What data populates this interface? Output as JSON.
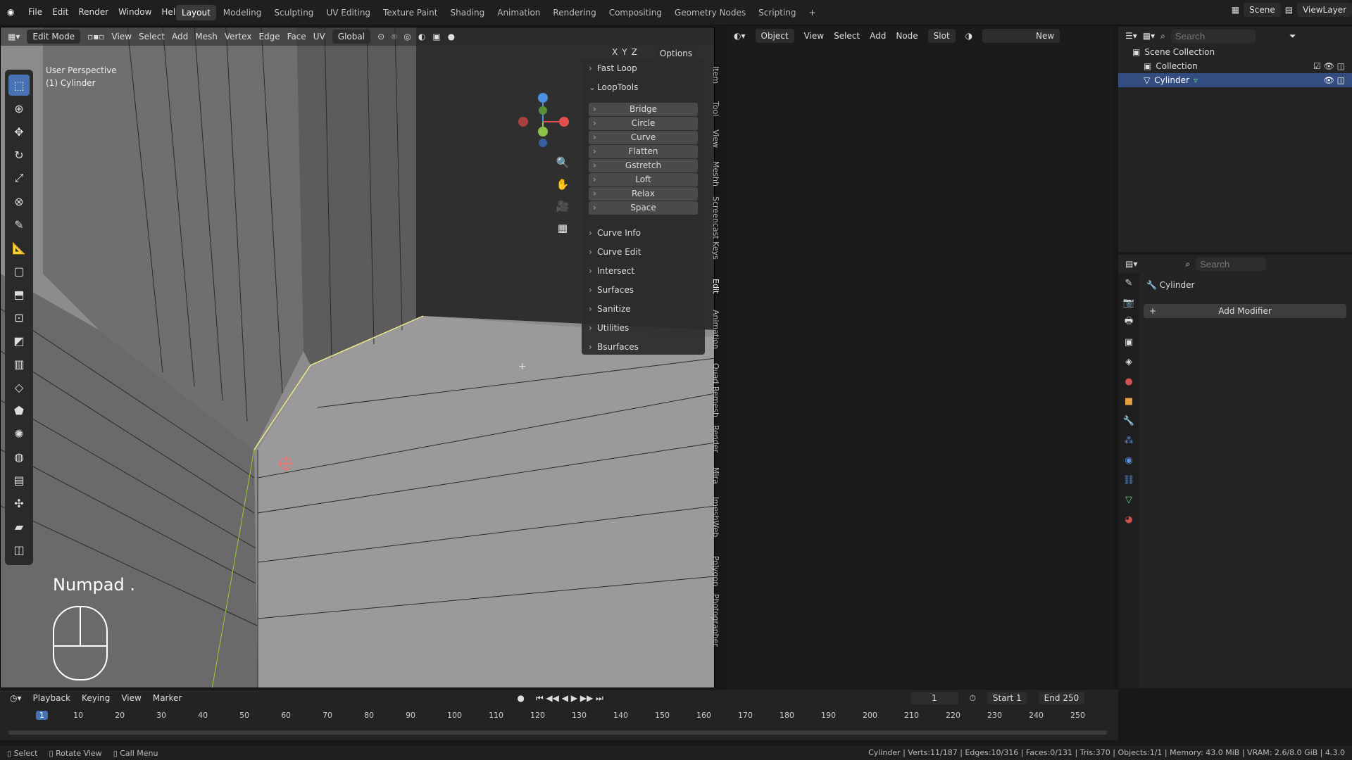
{
  "topbar": {
    "menus": [
      "File",
      "Edit",
      "Render",
      "Window",
      "Help"
    ],
    "workspaces": [
      "Layout",
      "Modeling",
      "Sculpting",
      "UV Editing",
      "Texture Paint",
      "Shading",
      "Animation",
      "Rendering",
      "Compositing",
      "Geometry Nodes",
      "Scripting",
      "+"
    ],
    "active_workspace": "Layout",
    "scene": "Scene",
    "view_layer": "ViewLayer"
  },
  "viewport": {
    "mode": "Edit Mode",
    "menus": [
      "View",
      "Select",
      "Add",
      "Mesh",
      "Vertex",
      "Edge",
      "Face",
      "UV"
    ],
    "orientation": "Global",
    "info_line1": "User Perspective",
    "info_line2": "(1) Cylinder",
    "options": "Options",
    "axes": [
      "X",
      "Y",
      "Z"
    ],
    "key_hint": "Numpad ."
  },
  "npanel": {
    "fast_loop": "Fast Loop",
    "looptools": "LoopTools",
    "loop_buttons": [
      "Bridge",
      "Circle",
      "Curve",
      "Flatten",
      "Gstretch",
      "Loft",
      "Relax",
      "Space"
    ],
    "sections": [
      "Curve Info",
      "Curve Edit",
      "Intersect",
      "Surfaces",
      "Sanitize",
      "Utilities",
      "Bsurfaces"
    ]
  },
  "side_tabs": [
    "Item",
    "Tool",
    "View",
    "Meshh",
    "Screencast Keys",
    "Edit",
    "Animation",
    "Quad Remesh",
    "Render",
    "Mira",
    "ImeshWeb",
    "Polygon",
    "Photographer"
  ],
  "node_editor": {
    "object": "Object",
    "menus": [
      "View",
      "Select",
      "Add",
      "Node"
    ],
    "slot": "Slot",
    "new": "New"
  },
  "outliner": {
    "search_placeholder": "Search",
    "scene_collection": "Scene Collection",
    "collection": "Collection",
    "object": "Cylinder"
  },
  "properties": {
    "search_placeholder": "Search",
    "object": "Cylinder",
    "add_modifier": "Add Modifier"
  },
  "timeline": {
    "menus": [
      "Playback",
      "Keying",
      "View",
      "Marker"
    ],
    "current_frame": "1",
    "start_label": "Start",
    "start": "1",
    "end_label": "End",
    "end": "250",
    "ticks": [
      "1",
      "10",
      "20",
      "30",
      "40",
      "50",
      "60",
      "70",
      "80",
      "90",
      "100",
      "110",
      "120",
      "130",
      "140",
      "150",
      "160",
      "170",
      "180",
      "190",
      "200",
      "210",
      "220",
      "230",
      "240",
      "250"
    ]
  },
  "statusbar": {
    "select": "Select",
    "rotate": "Rotate View",
    "call_menu": "Call Menu",
    "stats": "Cylinder | Verts:11/187 | Edges:10/316 | Faces:0/131 | Tris:370 | Objects:1/1 | Memory: 43.0 MiB | VRAM: 2.6/8.0 GiB | 4.3.0"
  }
}
